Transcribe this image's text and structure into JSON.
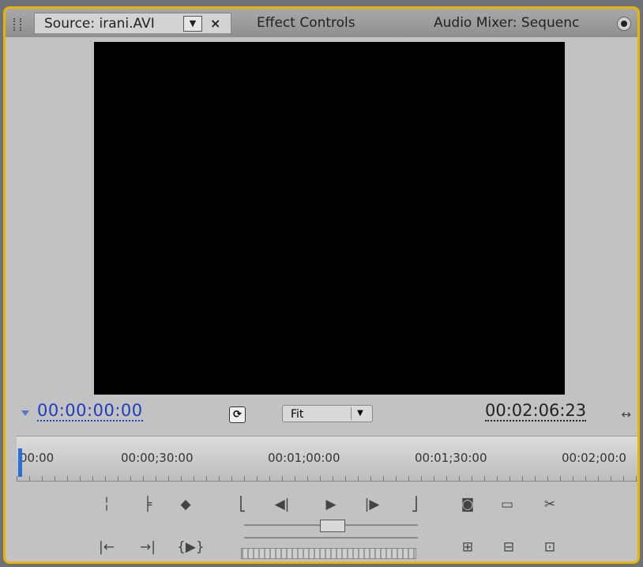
{
  "tabs": {
    "source_label": "Source: irani.AVI",
    "source_dropdown_icon": "▼",
    "source_close_icon": "×",
    "effect_controls": "Effect Controls",
    "audio_mixer": "Audio Mixer: Sequenc"
  },
  "timecode": {
    "current": "00:00:00:00",
    "duration": "00:02:06:23"
  },
  "zoom": {
    "value": "Fit"
  },
  "ruler": {
    "labels": [
      "00:00",
      "00:00;30:00",
      "00:01;00:00",
      "00:01;30:00",
      "00:02;00:0"
    ]
  },
  "icons": {
    "panel_menu": "panel-menu-icon",
    "safe_margins": "clock-icon",
    "expand": "expand-arrows-icon"
  },
  "colors": {
    "accent_border": "#e8b400",
    "timecode_blue": "#1e3cc0"
  }
}
